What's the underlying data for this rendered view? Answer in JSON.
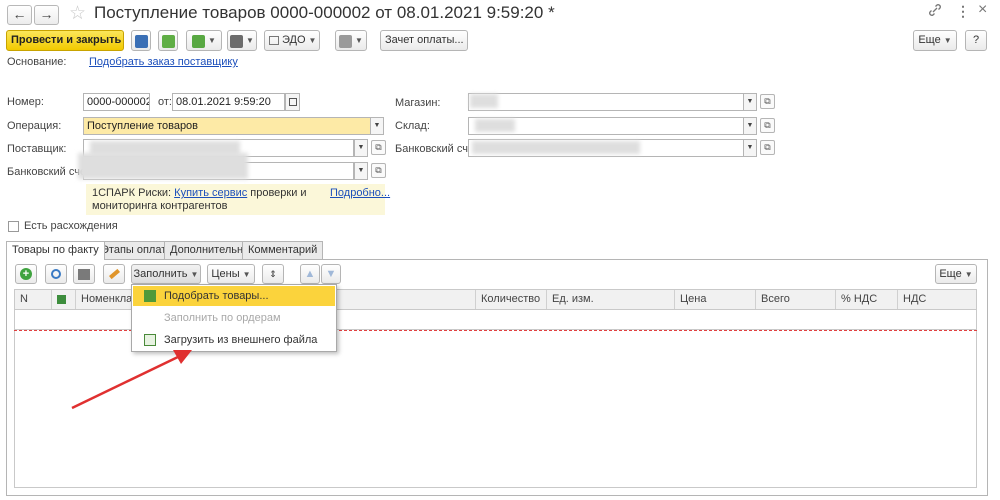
{
  "window": {
    "title": "Поступление товаров 0000-000002 от 08.01.2021 9:59:20 *",
    "back_icon": "←",
    "forward_icon": "→",
    "star_icon": "☆",
    "link_icon": "🔗",
    "more_icon": "⋮",
    "close_icon": "×"
  },
  "toolbar": {
    "post_close": "Провести и закрыть",
    "edo": "ЭДО",
    "payment_offset": "Зачет оплаты...",
    "more": "Еще",
    "help": "?"
  },
  "basis": {
    "label": "Основание:",
    "link": "Подобрать заказ поставщику"
  },
  "form": {
    "number_label": "Номер:",
    "number_value": "0000-000002",
    "from_label": "от:",
    "date_value": "08.01.2021  9:59:20",
    "operation_label": "Операция:",
    "operation_value": "Поступление товаров",
    "supplier_label": "Поставщик:",
    "bank_label": "Банковский счет",
    "store_label": "Магазин:",
    "warehouse_label": "Склад:",
    "bank2_label": "Банковский счет:"
  },
  "spark": {
    "text1": "1СПАРК Риски: ",
    "buy_link": "Купить сервис",
    "text2": " проверки и",
    "text3": "мониторинга контрагентов",
    "more_link": "Подробно..."
  },
  "discrepancy": {
    "label": "Есть расхождения",
    "checked": false
  },
  "tabs": [
    {
      "label": "Товары по факту",
      "active": true
    },
    {
      "label": "Этапы оплат",
      "active": false
    },
    {
      "label": "Дополнительно",
      "active": false
    },
    {
      "label": "Комментарий",
      "active": false
    }
  ],
  "table_toolbar": {
    "fill": "Заполнить",
    "prices": "Цены",
    "more": "Еще"
  },
  "table": {
    "columns": [
      "N",
      "",
      "Номенклатура",
      "Количество",
      "Ед. изм.",
      "Цена",
      "Всего",
      "% НДС",
      "НДС"
    ]
  },
  "fill_menu": {
    "items": [
      {
        "label": "Подобрать товары...",
        "state": "selected"
      },
      {
        "label": "Заполнить по ордерам",
        "state": "disabled"
      },
      {
        "label": "Загрузить из внешнего файла",
        "state": "normal"
      }
    ]
  },
  "colors": {
    "accent_yellow": "#f2ca00",
    "highlight_field": "#fdeaa6",
    "menu_selected": "#fbd33c",
    "link": "#1c4fbb",
    "arrow": "#e03030"
  }
}
